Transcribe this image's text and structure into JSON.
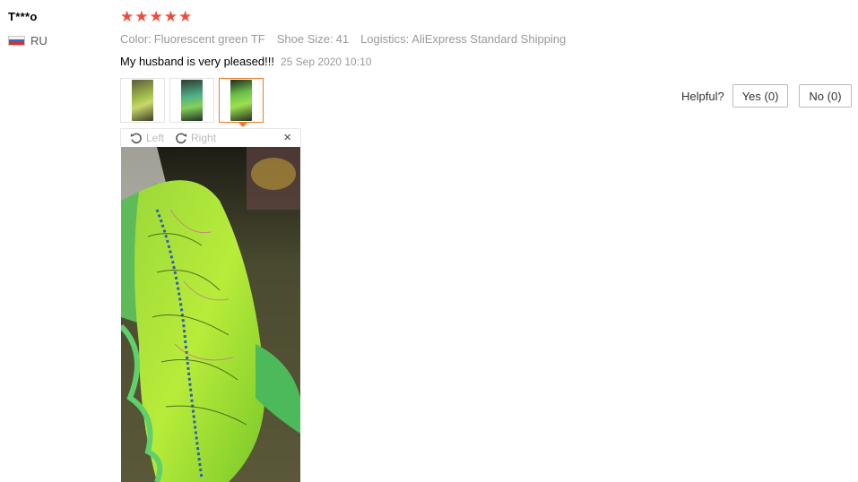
{
  "reviewer": {
    "name": "T***o",
    "country": "RU"
  },
  "rating": {
    "value": 5,
    "max": 5,
    "star_glyph": "★",
    "color": "#ee4c3a"
  },
  "attributes": [
    {
      "key": "Color:",
      "value": "Fluorescent green TF"
    },
    {
      "key": "Shoe Size:",
      "value": "41"
    },
    {
      "key": "Logistics:",
      "value": "AliExpress Standard Shipping"
    }
  ],
  "review": {
    "text": "My husband is very pleased!!!",
    "date": "25 Sep 2020 10:10"
  },
  "thumbnails": [
    {
      "icon": "shoe-photo-1"
    },
    {
      "icon": "shoe-photo-2"
    },
    {
      "icon": "shoe-photo-3",
      "selected": true
    }
  ],
  "viewer": {
    "rotate_left_label": "Left",
    "rotate_right_label": "Right",
    "close_glyph": "×"
  },
  "helpful": {
    "label": "Helpful?",
    "yes_label": "Yes (0)",
    "no_label": "No (0)"
  },
  "colors": {
    "accent": "#f07a2a",
    "muted_text": "#999999"
  }
}
